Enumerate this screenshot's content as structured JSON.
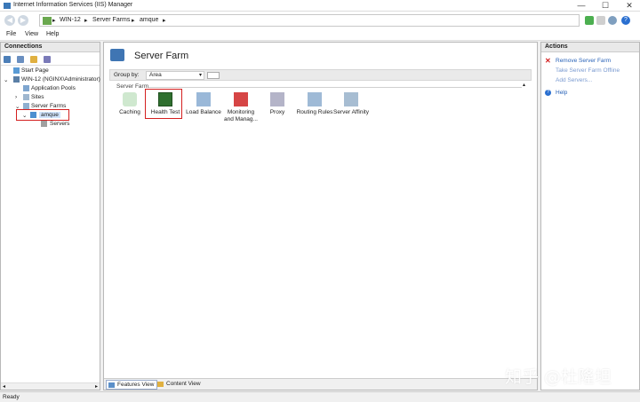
{
  "window": {
    "title": "Internet Information Services (IIS) Manager",
    "controls": [
      "—",
      "☐",
      "✕"
    ]
  },
  "address": {
    "crumbs": [
      "WIN-12",
      "Server Farms",
      "amque"
    ],
    "separator": "▸"
  },
  "menu": [
    "File",
    "View",
    "Help"
  ],
  "connections": {
    "header": "Connections",
    "tree": [
      {
        "label": "Start Page"
      },
      {
        "label": "WIN-12 (NGINX\\Administrator)"
      },
      {
        "label": "Application Pools"
      },
      {
        "label": "Sites"
      },
      {
        "label": "Server Farms"
      },
      {
        "label": "amque"
      },
      {
        "label": "Servers"
      }
    ]
  },
  "main": {
    "title": "Server Farm",
    "group_by_label": "Group by:",
    "group_by_value": "Area",
    "section_label": "Server Farm",
    "features": [
      "Caching",
      "Health Test",
      "Load Balance",
      "Monitoring and Manag...",
      "Proxy",
      "Routing Rules",
      "Server Affinity"
    ],
    "tabs": [
      "Features View",
      "Content View"
    ]
  },
  "actions": {
    "header": "Actions",
    "items": [
      "Remove Server Farm",
      "Take Server Farm Offline",
      "Add Servers...",
      "Help"
    ]
  },
  "status": "Ready",
  "watermark": "知乎 @杜隆坦",
  "colors": {
    "highlight": "#d42020",
    "link": "#2a63b8"
  }
}
